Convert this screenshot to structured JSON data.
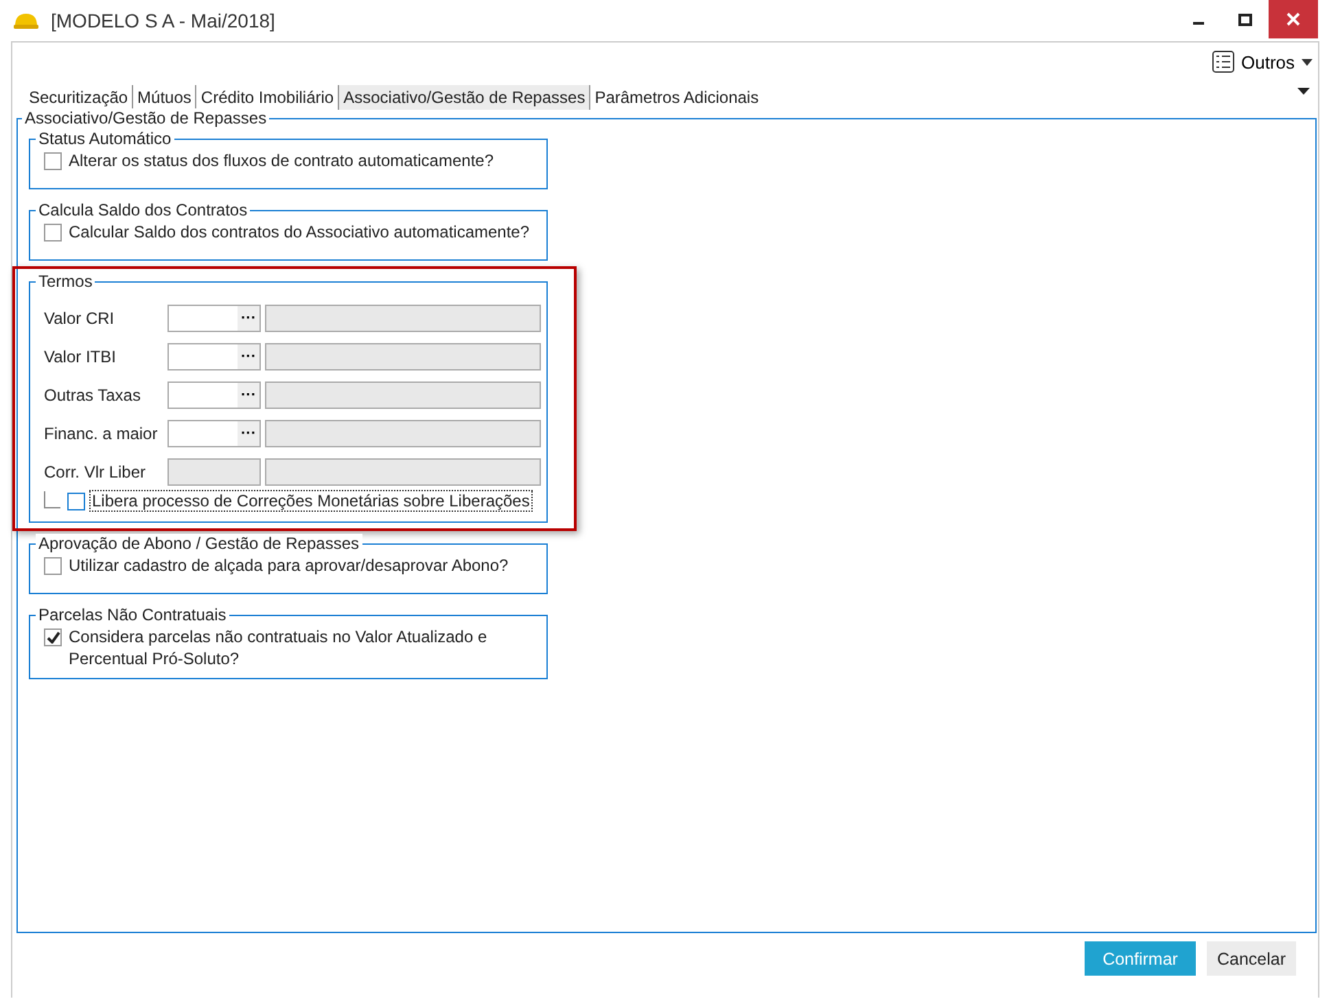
{
  "window": {
    "title": "[MODELO S A - Mai/2018]"
  },
  "toolbar": {
    "menu_label": "Outros"
  },
  "tabs": [
    {
      "label": "Securitização",
      "selected": false
    },
    {
      "label": "Mútuos",
      "selected": false
    },
    {
      "label": "Crédito Imobiliário",
      "selected": false
    },
    {
      "label": "Associativo/Gestão de Repasses",
      "selected": true
    },
    {
      "label": "Parâmetros Adicionais",
      "selected": false
    }
  ],
  "panel": {
    "title": "Associativo/Gestão de Repasses",
    "groups": [
      {
        "kind": "checkboxes",
        "title": "Status Automático",
        "options": [
          {
            "label": "Alterar os status dos fluxos de contrato automaticamente?",
            "checked": false
          }
        ]
      },
      {
        "kind": "checkboxes",
        "title": "Calcula Saldo dos Contratos",
        "options": [
          {
            "label": "Calcular Saldo dos contratos do Associativo automaticamente?",
            "checked": false
          }
        ]
      },
      {
        "kind": "fields",
        "title": "Termos",
        "highlighted": true,
        "fields": [
          {
            "label": "Valor CRI",
            "kind": "lookup",
            "button": "···"
          },
          {
            "label": "Valor ITBI",
            "kind": "lookup",
            "button": "···"
          },
          {
            "label": "Outras Taxas",
            "kind": "lookup",
            "button": "···"
          },
          {
            "label": "Financ. a maior",
            "kind": "lookup",
            "button": "···"
          },
          {
            "label": "Corr. Vlr Liber",
            "kind": "readonly"
          }
        ],
        "sub_option": {
          "label": "Libera processo de Correções Monetárias sobre Liberações",
          "checked": false,
          "focused": true
        }
      },
      {
        "kind": "checkboxes",
        "title": "Aprovação de Abono / Gestão de Repasses",
        "options": [
          {
            "label": "Utilizar cadastro de alçada para aprovar/desaprovar Abono?",
            "checked": false
          }
        ]
      },
      {
        "kind": "checkboxes",
        "title": "Parcelas Não Contratuais",
        "options": [
          {
            "label": "Considera parcelas não contratuais no Valor Atualizado e Percentual Pró-Soluto?",
            "checked": true
          }
        ]
      }
    ]
  },
  "buttons": [
    {
      "label": "Confirmar",
      "primary": true
    },
    {
      "label": "Cancelar",
      "primary": false
    }
  ]
}
